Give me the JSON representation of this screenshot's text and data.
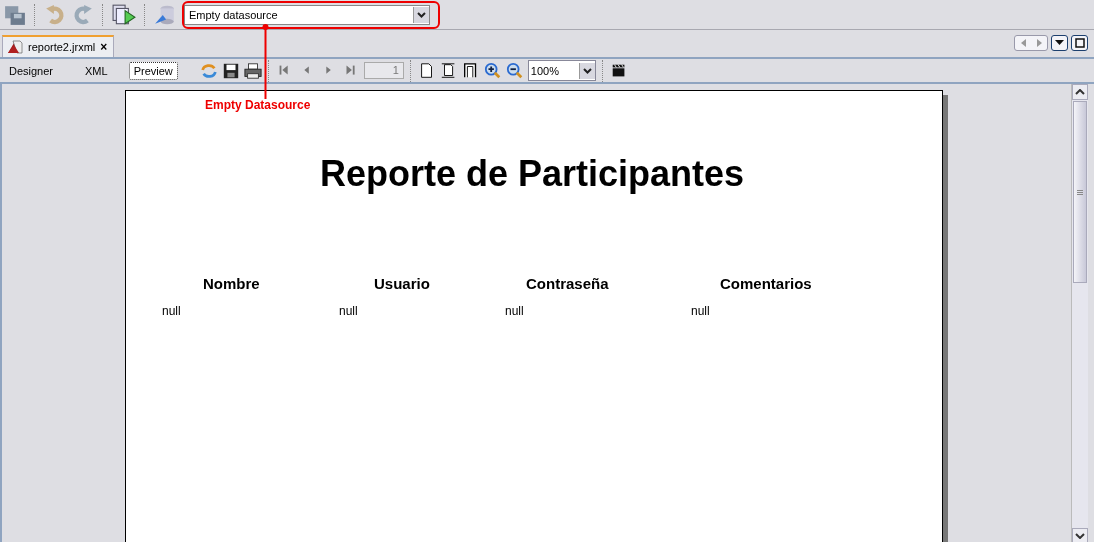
{
  "toolbar": {
    "datasource": "Empty datasource"
  },
  "annotation": {
    "label": "Empty Datasource"
  },
  "editor_tab": {
    "title": "reporte2.jrxml",
    "close": "×"
  },
  "view_tabs": [
    {
      "label": "Designer",
      "selected": false
    },
    {
      "label": "XML",
      "selected": false
    },
    {
      "label": "Preview",
      "selected": true
    }
  ],
  "page_field": "1",
  "zoom": "100%",
  "report": {
    "title": "Reporte de Participantes",
    "columns": [
      {
        "header": "Nombre",
        "value": "null"
      },
      {
        "header": "Usuario",
        "value": "null"
      },
      {
        "header": "Contraseña",
        "value": "null"
      },
      {
        "header": "Comentarios",
        "value": "null"
      }
    ]
  }
}
